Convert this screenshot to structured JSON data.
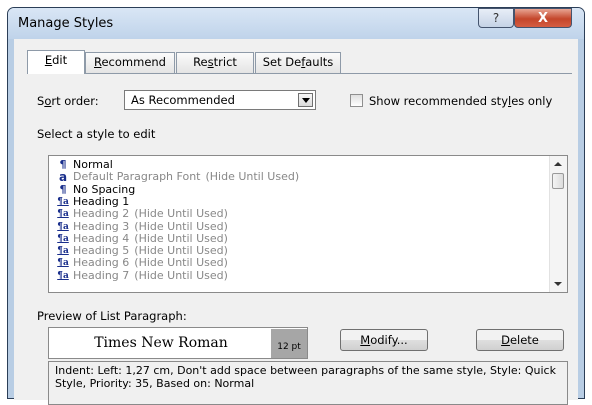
{
  "window": {
    "title": "Manage Styles",
    "help_glyph": "?",
    "close_glyph": "X"
  },
  "tabs": [
    {
      "pre": "",
      "key": "E",
      "post": "dit"
    },
    {
      "pre": "",
      "key": "R",
      "post": "ecommend"
    },
    {
      "pre": "Re",
      "key": "s",
      "post": "trict"
    },
    {
      "pre": "Set De",
      "key": "f",
      "post": "aults"
    }
  ],
  "sort": {
    "label_pre": "S",
    "label_key": "o",
    "label_post": "rt order:",
    "value": "As Recommended",
    "show_rec_pre": "Show recommended sty",
    "show_rec_key": "l",
    "show_rec_post": "es only"
  },
  "select_label": "Select a style to edit",
  "styles": [
    {
      "icon": "¶",
      "icon_name": "paragraph-icon",
      "name": "Normal",
      "note": "",
      "gray": false
    },
    {
      "icon": "a",
      "icon_name": "character-icon",
      "name": "Default Paragraph Font",
      "note": "(Hide Until Used)",
      "gray": true
    },
    {
      "icon": "¶",
      "icon_name": "paragraph-icon",
      "name": "No Spacing",
      "note": "",
      "gray": false
    },
    {
      "icon": "¶a",
      "icon_name": "linked-style-icon",
      "name": "Heading 1",
      "note": "",
      "gray": false
    },
    {
      "icon": "¶a",
      "icon_name": "linked-style-icon",
      "name": "Heading 2",
      "note": "(Hide Until Used)",
      "gray": true
    },
    {
      "icon": "¶a",
      "icon_name": "linked-style-icon",
      "name": "Heading 3",
      "note": "(Hide Until Used)",
      "gray": true
    },
    {
      "icon": "¶a",
      "icon_name": "linked-style-icon",
      "name": "Heading 4",
      "note": "(Hide Until Used)",
      "gray": true
    },
    {
      "icon": "¶a",
      "icon_name": "linked-style-icon",
      "name": "Heading 5",
      "note": "(Hide Until Used)",
      "gray": true
    },
    {
      "icon": "¶a",
      "icon_name": "linked-style-icon",
      "name": "Heading 6",
      "note": "(Hide Until Used)",
      "gray": true
    },
    {
      "icon": "¶a",
      "icon_name": "linked-style-icon",
      "name": "Heading 7",
      "note": "(Hide Until Used)",
      "gray": true
    }
  ],
  "preview": {
    "label": "Preview of List Paragraph:",
    "font": "Times New Roman",
    "size": "12 pt"
  },
  "buttons": {
    "modify_key": "M",
    "modify_post": "odify...",
    "delete_key": "D",
    "delete_post": "elete"
  },
  "description": "Indent: Left:  1,27 cm, Don't add space between paragraphs of the same style, Style: Quick Style, Priority: 35, Based on: Normal",
  "colors": {
    "accent": "#1a2f8c",
    "frame": "#b8cde4",
    "close": "#c4462b"
  }
}
